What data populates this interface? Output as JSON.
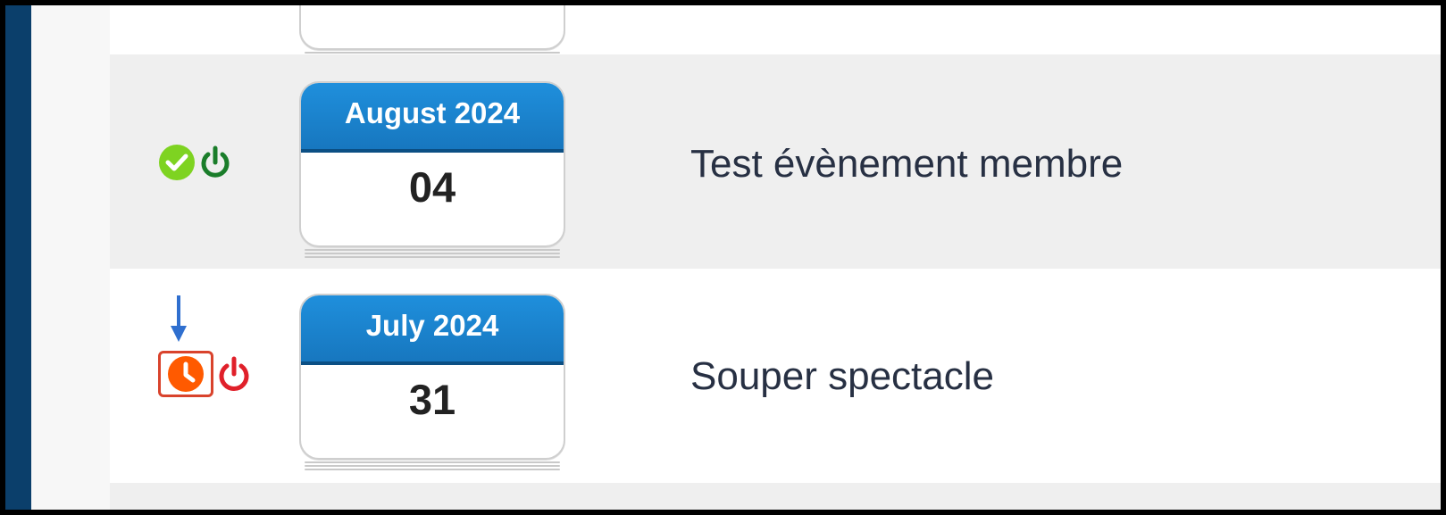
{
  "events": [
    {
      "calendar": {
        "month": "August 2024",
        "day": "04"
      },
      "title": "Test évènement membre",
      "status_icons": [
        "check-circle-icon",
        "power-icon"
      ],
      "colors": {
        "status": "#7ed321",
        "power": "#1a7d2a"
      }
    },
    {
      "calendar": {
        "month": "July 2024",
        "day": "31"
      },
      "title": "Souper spectacle",
      "status_icons": [
        "clock-icon",
        "power-icon"
      ],
      "colors": {
        "status": "#ff5a00",
        "power": "#e0202a",
        "highlight": "#d9432c"
      }
    }
  ],
  "theme": {
    "sidebar": "#0b3f6b",
    "calendar_header": "#1a85d0",
    "row_alt": "#efefef"
  }
}
